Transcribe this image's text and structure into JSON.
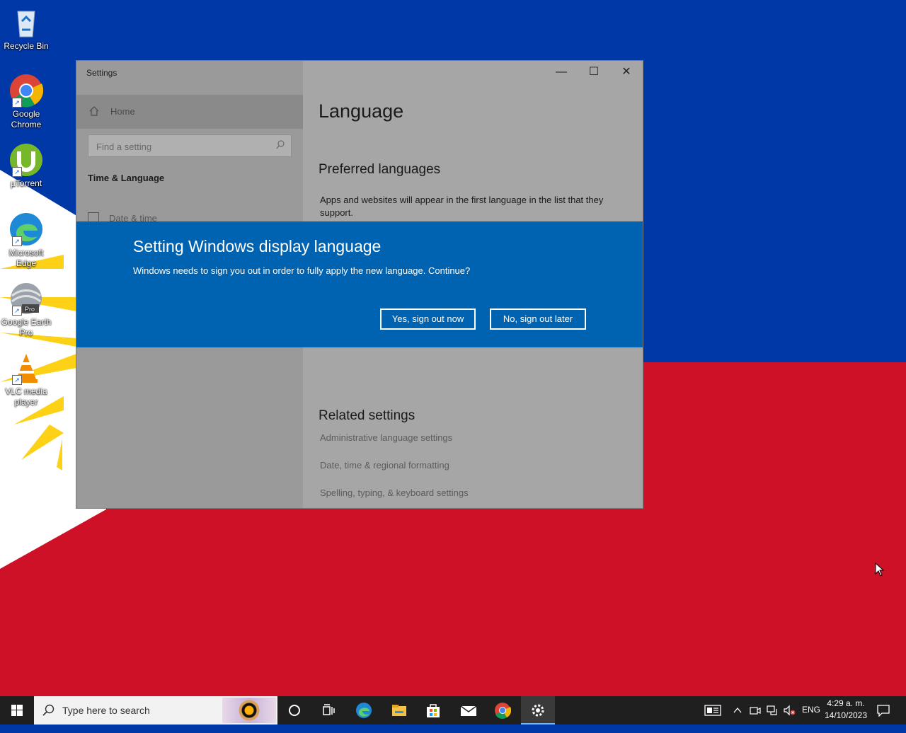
{
  "desktop": {
    "icons": [
      {
        "label": "Recycle Bin"
      },
      {
        "label": "Google Chrome"
      },
      {
        "label": "µTorrent"
      },
      {
        "label": "Microsoft Edge"
      },
      {
        "label": "Google Earth Pro"
      },
      {
        "label": "VLC media player"
      }
    ]
  },
  "settings": {
    "title": "Settings",
    "nav": {
      "home_label": "Home",
      "search_placeholder": "Find a setting",
      "section_title": "Time & Language",
      "items": [
        {
          "label": "Date & time"
        }
      ]
    },
    "content": {
      "page_title": "Language",
      "preferred_heading": "Preferred languages",
      "preferred_desc": "Apps and websites will appear in the first language in the list that they support.",
      "related_heading": "Related settings",
      "related_links": [
        {
          "label": "Administrative language settings"
        },
        {
          "label": "Date, time & regional formatting"
        },
        {
          "label": "Spelling, typing, & keyboard settings"
        }
      ]
    },
    "window_buttons": {
      "minimize": "—",
      "maximize": "☐",
      "close": "✕"
    }
  },
  "dialog": {
    "title": "Setting Windows display language",
    "message": "Windows needs to sign you out in order to fully apply the new language. Continue?",
    "primary_button": "Yes, sign out now",
    "secondary_button": "No, sign out later"
  },
  "taskbar": {
    "search_placeholder": "Type here to search",
    "apps": [
      "cortana-icon",
      "task-view-icon",
      "edge-icon",
      "file-explorer-icon",
      "store-icon",
      "mail-icon",
      "chrome-icon",
      "settings-icon"
    ],
    "tray": {
      "language": "ENG",
      "time": "4:29 a. m.",
      "date": "14/10/2023"
    }
  },
  "colors": {
    "flag_blue": "#0038a8",
    "flag_red": "#ce1126",
    "flag_yellow": "#fcd116",
    "dialog_blue": "#0063b1"
  }
}
